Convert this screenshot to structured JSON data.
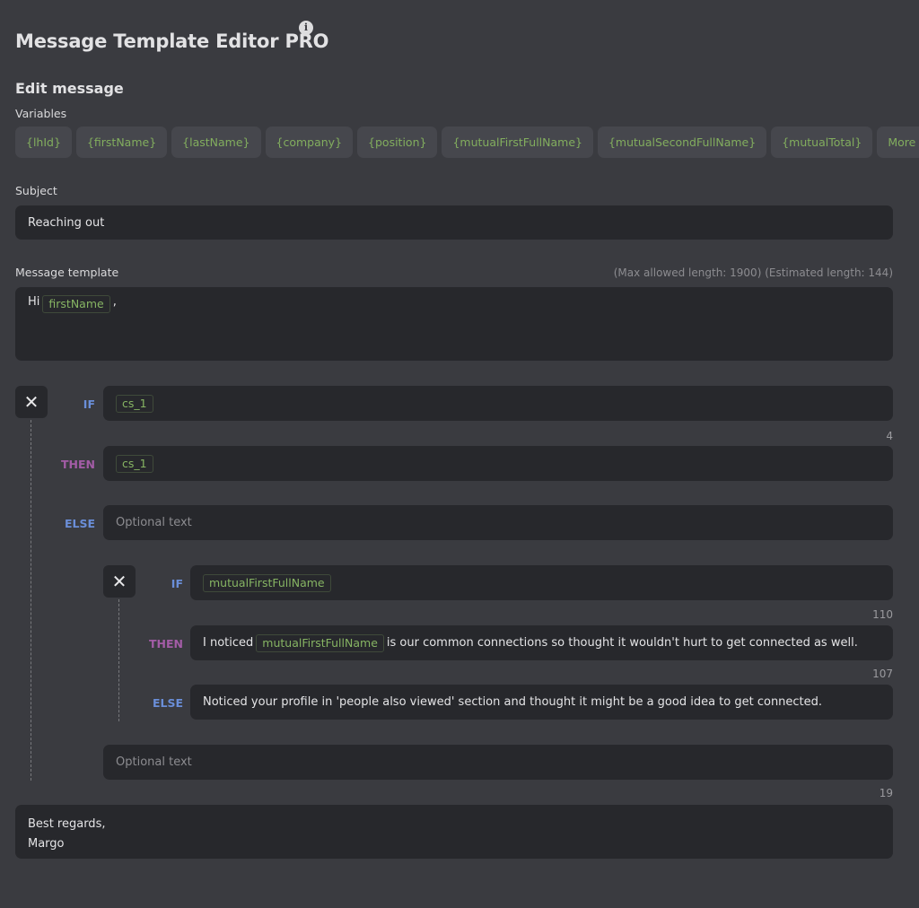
{
  "app": {
    "title": "Message Template Editor PRO",
    "info_icon": "i"
  },
  "editor": {
    "section_title": "Edit message",
    "variables_label": "Variables",
    "variables": [
      "{lhId}",
      "{firstName}",
      "{lastName}",
      "{company}",
      "{position}",
      "{mutualFirstFullName}",
      "{mutualSecondFullName}",
      "{mutualTotal}"
    ],
    "more_label": "More",
    "more_icon": "•••",
    "subject_label": "Subject",
    "subject_value": "Reaching out",
    "template_label": "Message template",
    "length_note": "(Max allowed length: 1900) (Estimated length: 144)",
    "template": {
      "prefix": "Hi",
      "variable": "firstName",
      "suffix": ","
    }
  },
  "condition": {
    "close_icon": "✕",
    "if_label": "IF",
    "then_label": "THEN",
    "else_label": "ELSE",
    "if_variable": "cs_1",
    "then_variable": "cs_1",
    "then_counter": "4",
    "else_placeholder": "Optional text",
    "nested": {
      "close_icon": "✕",
      "if_label": "IF",
      "then_label": "THEN",
      "else_label": "ELSE",
      "if_variable": "mutualFirstFullName",
      "then_counter": "110",
      "then_prefix": "I noticed",
      "then_variable": "mutualFirstFullName",
      "then_suffix": "is our common connections so thought it wouldn't hurt to get connected as well.",
      "else_counter": "107",
      "else_text": "Noticed your profile in 'people also viewed' section and thought it might be a good idea to get connected."
    },
    "after_placeholder": "Optional text"
  },
  "footer": {
    "counter": "19",
    "line1": "Best regards,",
    "line2": "Margo"
  }
}
